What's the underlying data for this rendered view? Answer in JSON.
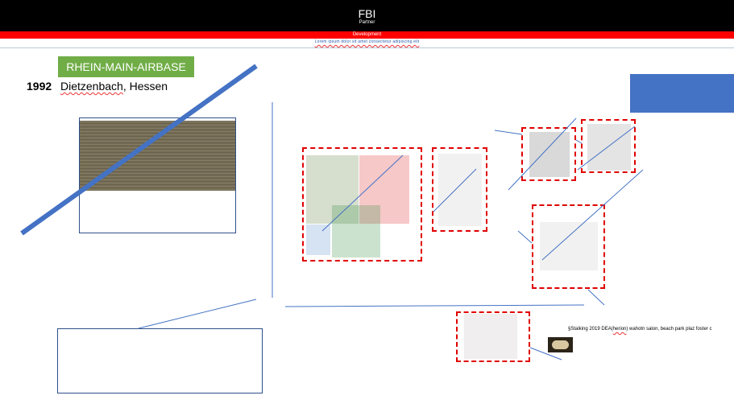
{
  "header": {
    "title": "FBI",
    "subtitle": "Partner",
    "section": "Development",
    "nav_text": "Lorem ipsum dolor sit amet consectetur adipiscing elit"
  },
  "badge": {
    "label": "RHEIN-MAIN-AIRBASE"
  },
  "location": {
    "year": "1992",
    "place_underlined": "Dietzenbach",
    "place_rest": ", Hessen"
  },
  "caption": {
    "prefix": "§Stalking 2019 DEA(",
    "underlined": "herion",
    "suffix": ") wahotn salon, beach park plaz foster c"
  },
  "colors": {
    "header_bg": "#000000",
    "section_bar": "#ff0000",
    "badge": "#70ad47",
    "blue_block": "#4472c4",
    "dashed_border": "#e00000",
    "connector_line": "#4472c4"
  }
}
